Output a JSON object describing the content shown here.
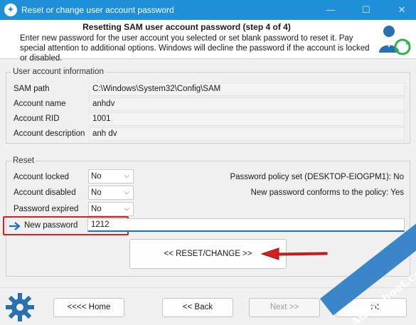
{
  "window": {
    "title": "Reset or change user account password",
    "minimize_icon": "minimize-icon",
    "maximize_icon": "maximize-icon",
    "close_icon": "close-icon"
  },
  "header": {
    "title": "Resetting SAM user account password (step 4 of 4)",
    "description": "Enter new password for the user account you selected or set blank password to reset it. Pay special attention to additional options. Windows will decline the password if the account is locked or disabled.",
    "icon": "user-refresh-icon"
  },
  "account_info": {
    "group_label": "User account information",
    "fields": [
      {
        "label": "SAM path",
        "value": "C:\\Windows\\System32\\Config\\SAM"
      },
      {
        "label": "Account name",
        "value": "anhdv"
      },
      {
        "label": "Account RID",
        "value": "1001"
      },
      {
        "label": "Account description",
        "value": "anh dv"
      }
    ]
  },
  "reset": {
    "group_label": "Reset",
    "account_locked": {
      "label": "Account locked",
      "value": "No"
    },
    "account_disabled": {
      "label": "Account disabled",
      "value": "No"
    },
    "password_expired": {
      "label": "Password expired",
      "value": "No"
    },
    "policy_set": "Password policy set (DESKTOP-EIOGPM1): No",
    "policy_conforms": "New password conforms to the policy: Yes",
    "new_password": {
      "label": "New password",
      "value": "1212"
    },
    "reset_button": "<< RESET/CHANGE >>",
    "highlight_color": "#d42020",
    "arrow_color": "#d42020"
  },
  "footer": {
    "home_button": "<<<< Home",
    "back_button": "<< Back",
    "next_button": "Next >>",
    "exit_button": "xit",
    "settings_icon": "gear-icon"
  },
  "watermark": "Anhdvboot.com",
  "colors": {
    "titlebar": "#1f8fd8",
    "accent": "#1f6fc8"
  }
}
